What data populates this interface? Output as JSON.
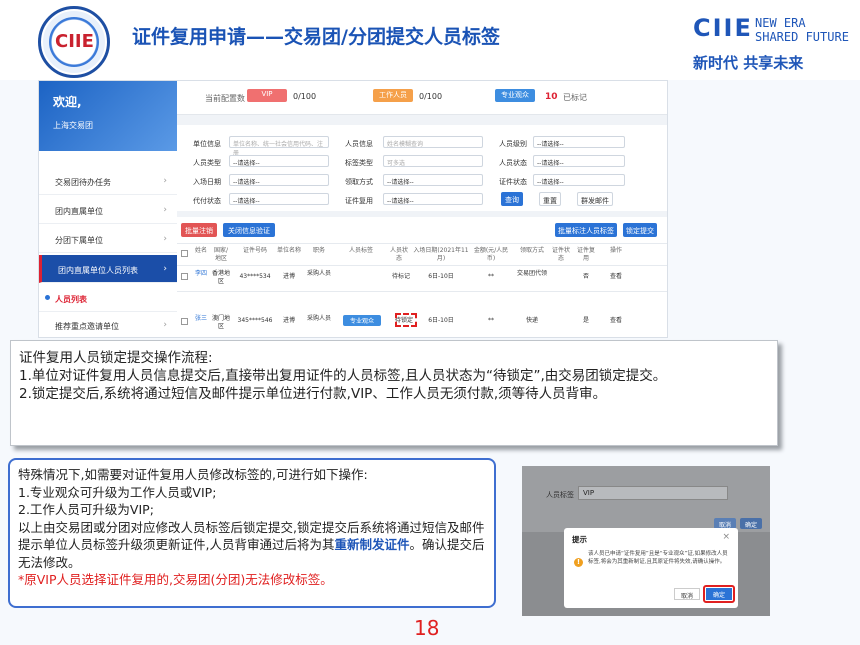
{
  "header": {
    "title": "证件复用申请——交易团/分团提交人员标签",
    "logo_text": "CIIE",
    "brand_main": "CIIE",
    "brand_sub1": "NEW ERA",
    "brand_sub2": "SHARED FUTURE",
    "brand_slogan": "新时代 共享未来"
  },
  "app": {
    "sidebar": {
      "welcome": "欢迎,",
      "org": "上海交易团",
      "items": [
        {
          "label": "交易团待办任务"
        },
        {
          "label": "团内直属单位"
        },
        {
          "label": "分团下属单位"
        },
        {
          "label": "团内直属单位人员列表"
        },
        {
          "label": "人员列表"
        },
        {
          "label": "推荐重点邀请单位"
        }
      ]
    },
    "quota": {
      "label": "当前配置数",
      "vip_tag": "VIP",
      "vip_count": "0/100",
      "staff_tag": "工作人员",
      "staff_count": "0/100",
      "pro_tag": "专业观众",
      "pro_count": "10",
      "pro_suffix": "已标记"
    },
    "filters": {
      "unit_info_label": "单位信息",
      "unit_info_placeholder": "单位名称、统一社会信用代码、注册",
      "person_info_label": "人员信息",
      "person_info_placeholder": "姓名模糊查询",
      "level_label": "人员级别",
      "level_value": "--请选择--",
      "person_type_label": "人员类型",
      "person_type_value": "--请选择--",
      "tag_type_label": "标签类型",
      "tag_type_value": "可多选",
      "person_status_label": "人员状态",
      "person_status_value": "--请选择--",
      "entry_date_label": "入场日期",
      "entry_date_value": "--请选择--",
      "pickup_label": "领取方式",
      "pickup_value": "--请选择--",
      "cert_status_label": "证件状态",
      "cert_status_value": "--请选择--",
      "pay_status_label": "代付状态",
      "pay_status_value": "--请选择--",
      "reuse_label": "证件复用",
      "reuse_value": "--请选择--",
      "search_btn": "查询",
      "reset_btn": "重置",
      "mail_btn": "群发邮件"
    },
    "actions": {
      "batch_cancel": "批量注销",
      "close_verify": "关闭信息验证",
      "batch_tag": "批量标注人员标签",
      "lock_submit": "锁定提交"
    },
    "table": {
      "headers": [
        "",
        "姓名",
        "国家/地区",
        "证件号码",
        "单位名称",
        "职务",
        "人员标签",
        "人员状态",
        "入场日期(2021年11月)",
        "金额(元/人民币)",
        "领取方式",
        "证件状态",
        "证件复用",
        "操作"
      ],
      "rows": [
        {
          "name": "李四",
          "region": "香港地区",
          "id": "43****534",
          "unit": "进博",
          "title": "采购人员",
          "tag": "",
          "status": "待标记",
          "date": "6日-10日",
          "amount": "**",
          "pickup": "交易团代领",
          "cert": "",
          "reuse": "否",
          "op": "查看"
        },
        {
          "name": "张三",
          "region": "澳门地区",
          "id": "345****546",
          "unit": "进博",
          "title": "采购人员",
          "tag": "专业观众",
          "status": "待锁定",
          "date": "6日-10日",
          "amount": "**",
          "pickup": "快递",
          "cert": "",
          "reuse": "是",
          "op": "查看"
        }
      ]
    }
  },
  "process": {
    "title": "证件复用人员锁定提交操作流程:",
    "step1": "1.单位对证件复用人员信息提交后,直接带出复用证件的人员标签,且人员状态为“待锁定”,由交易团锁定提交。",
    "step2": "2.锁定提交后,系统将通过短信及邮件提示单位进行付款,VIP、工作人员无须付款,须等待人员背审。"
  },
  "special": {
    "intro": "特殊情况下,如需要对证件复用人员修改标签的,可进行如下操作:",
    "p1": "1.专业观众可升级为工作人员或VIP;",
    "p2": "2.工作人员可升级为VIP;",
    "p3a": "以上由交易团或分团对应修改人员标签后锁定提交,锁定提交后系统将通过短信及邮件提示单位人员标签升级须更新证件,人员背审通过后将为其",
    "p3b": "重新制发证件",
    "p3c": "。确认提交后无法修改。",
    "note": "*原VIP人员选择证件复用的,交易团(分团)无法修改标签。"
  },
  "dialog_shot": {
    "field_label": "人员标签",
    "field_value": "VIP",
    "cancel_small": "取消",
    "ok_small": "确定",
    "title": "提示",
    "message": "该人员已申请“证件复用”且是“专业观众”证,如果修改人员标签,将会为其重新制证,且其原证件将失效,请确认操作。",
    "cancel": "取消",
    "confirm": "确定"
  },
  "page_number": "18",
  "colors": {
    "brand_blue": "#1f56b8",
    "accent_red": "#e02020"
  }
}
